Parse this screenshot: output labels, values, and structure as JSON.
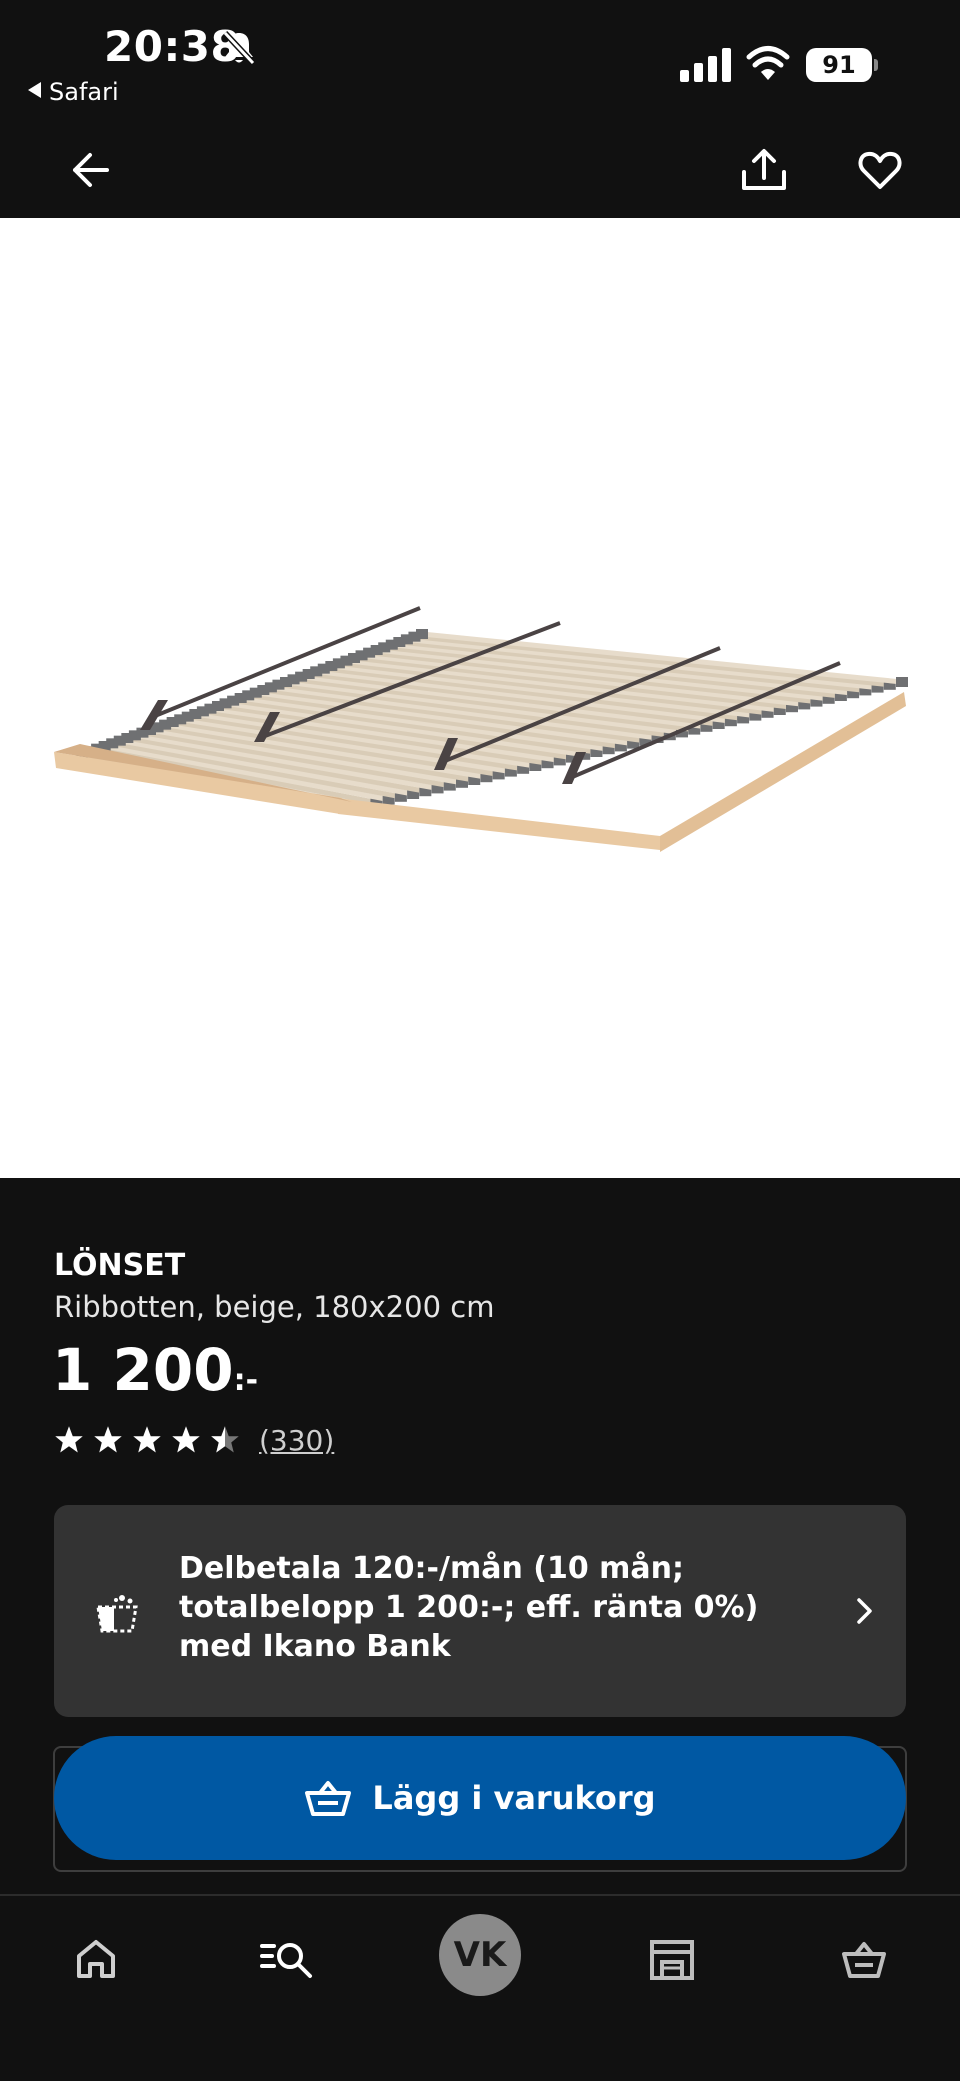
{
  "status_bar": {
    "time": "20:38",
    "back_app": "Safari",
    "battery": "91",
    "icons": [
      "bell-off-icon",
      "signal-icon",
      "wifi-icon",
      "battery-icon"
    ]
  },
  "nav": {
    "icons": [
      "back-arrow-icon",
      "share-icon",
      "heart-icon"
    ]
  },
  "product": {
    "name": "LÖNSET",
    "description": "Ribbotten, beige, 180x200 cm",
    "price": "1 200",
    "price_suffix": ":-",
    "rating": 4.5,
    "rating_max": 5,
    "review_count": "(330)"
  },
  "finance": {
    "line1": "Delbetala 120:-/mån (10 mån;",
    "line2": "totalbelopp 1 200:-; eff. ränta 0%)",
    "line3": "med Ikano Bank",
    "icon": "installment-basket-icon"
  },
  "cart_button": {
    "label": "Lägg i varukorg",
    "color": "#0058a3"
  },
  "tab_bar": {
    "avatar_initials": "VK",
    "icons": [
      "home-icon",
      "search-icon",
      "avatar",
      "store-icon",
      "cart-icon"
    ]
  },
  "colors": {
    "background": "#111111",
    "card": "#333333",
    "accent": "#0058a3"
  }
}
